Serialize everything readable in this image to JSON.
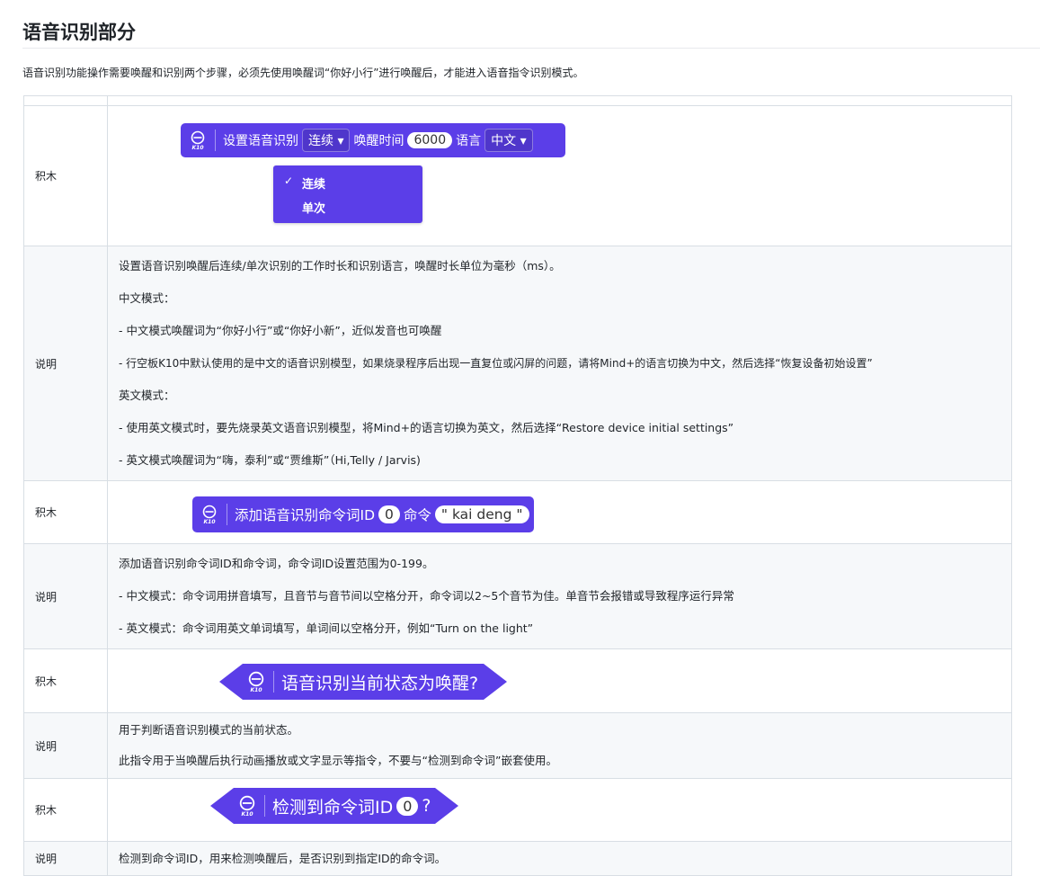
{
  "page": {
    "title": "语音识别部分",
    "intro": "语音识别功能操作需要唤醒和识别两个步骤，必须先使用唤醒词“你好小行”进行唤醒后，才能进入语音指令识别模式。"
  },
  "rows": [
    {
      "label": "积木",
      "block": {
        "k10": "K10",
        "text1": "设置语音识别",
        "dropdown1": "连续 ▾",
        "text2": "唤醒时间",
        "value": "6000",
        "text3": "语言",
        "dropdown2": "中文 ▾",
        "menu": {
          "check": "✓",
          "items": [
            "连续",
            "单次"
          ]
        }
      }
    },
    {
      "label": "说明",
      "lines": [
        "设置语音识别唤醒后连续/单次识别的工作时长和识别语言，唤醒时长单位为毫秒（ms）。",
        "中文模式：",
        "- 中文模式唤醒词为“你好小行”或“你好小新”，近似发音也可唤醒",
        "- 行空板K10中默认使用的是中文的语音识别模型，如果烧录程序后出现一直复位或闪屏的问题，请将Mind+的语言切换为中文，然后选择“恢复设备初始设置”",
        "英文模式：",
        "- 使用英文模式时，要先烧录英文语音识别模型，将Mind+的语言切换为英文，然后选择“Restore device initial settings”",
        "- 英文模式唤醒词为“嗨，泰利”或“贾维斯”（Hi,Telly / Jarvis)"
      ]
    },
    {
      "label": "积木",
      "block": {
        "k10": "K10",
        "text1": "添加语音识别命令词ID",
        "value": "0",
        "text2": "命令",
        "string": "\" kai deng \""
      }
    },
    {
      "label": "说明",
      "lines": [
        "添加语音识别命令词ID和命令词，命令词ID设置范围为0-199。",
        "- 中文模式：命令词用拼音填写，且音节与音节间以空格分开，命令词以2~5个音节为佳。单音节会报错或导致程序运行异常",
        "- 英文模式：命令词用英文单词填写，单词间以空格分开，例如“Turn on the light”"
      ]
    },
    {
      "label": "积木",
      "block": {
        "k10": "K10",
        "text1": "语音识别当前状态为唤醒?"
      }
    },
    {
      "label": "说明",
      "lines": [
        "用于判断语音识别模式的当前状态。",
        "此指令用于当唤醒后执行动画播放或文字显示等指令，不要与“检测到命令词”嵌套使用。"
      ]
    },
    {
      "label": "积木",
      "block": {
        "k10": "K10",
        "text1": "检测到命令词ID",
        "value": "0",
        "text2": "?"
      }
    },
    {
      "label": "说明",
      "lines": [
        "检测到命令词ID，用来检测唤醒后，是否识别到指定ID的命令词。"
      ]
    }
  ],
  "colors": {
    "block": "#5b3ee8",
    "border": "#d8dee4",
    "desc_bg": "#f6f8fa"
  }
}
